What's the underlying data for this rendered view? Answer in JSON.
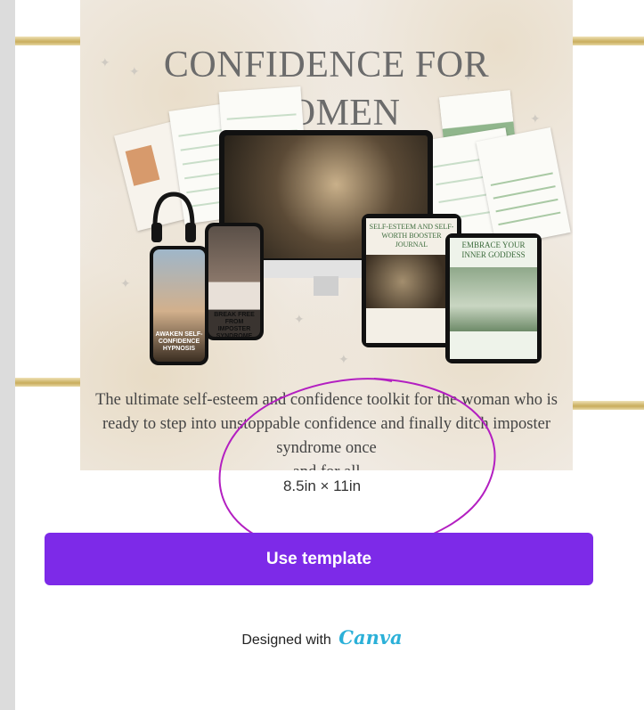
{
  "preview": {
    "title_line1": "CONFIDENCE FOR",
    "title_line2": "WOMEN",
    "description": "The ultimate self-esteem and confidence toolkit for the woman who is ready to step into unstoppable confidence and finally ditch imposter syndrome once",
    "description_tail": "and for all",
    "phone_text": "AWAKEN SELF-CONFIDENCE HYPNOSIS",
    "phone2_text": "BREAK FREE FROM IMPOSTER SYNDROME",
    "tablet1_title": "SELF-ESTEEM AND SELF-WORTH BOOSTER JOURNAL",
    "tablet2_title": "EMBRACE YOUR INNER GODDESS"
  },
  "size_label": "8.5in × 11in",
  "use_template_label": "Use template",
  "designed_with": "Designed with",
  "canva_brand": "Canva",
  "colors": {
    "accent": "#7d2ae8",
    "canva_brand": "#2bb0d8",
    "annotation": "#b31fc1"
  }
}
